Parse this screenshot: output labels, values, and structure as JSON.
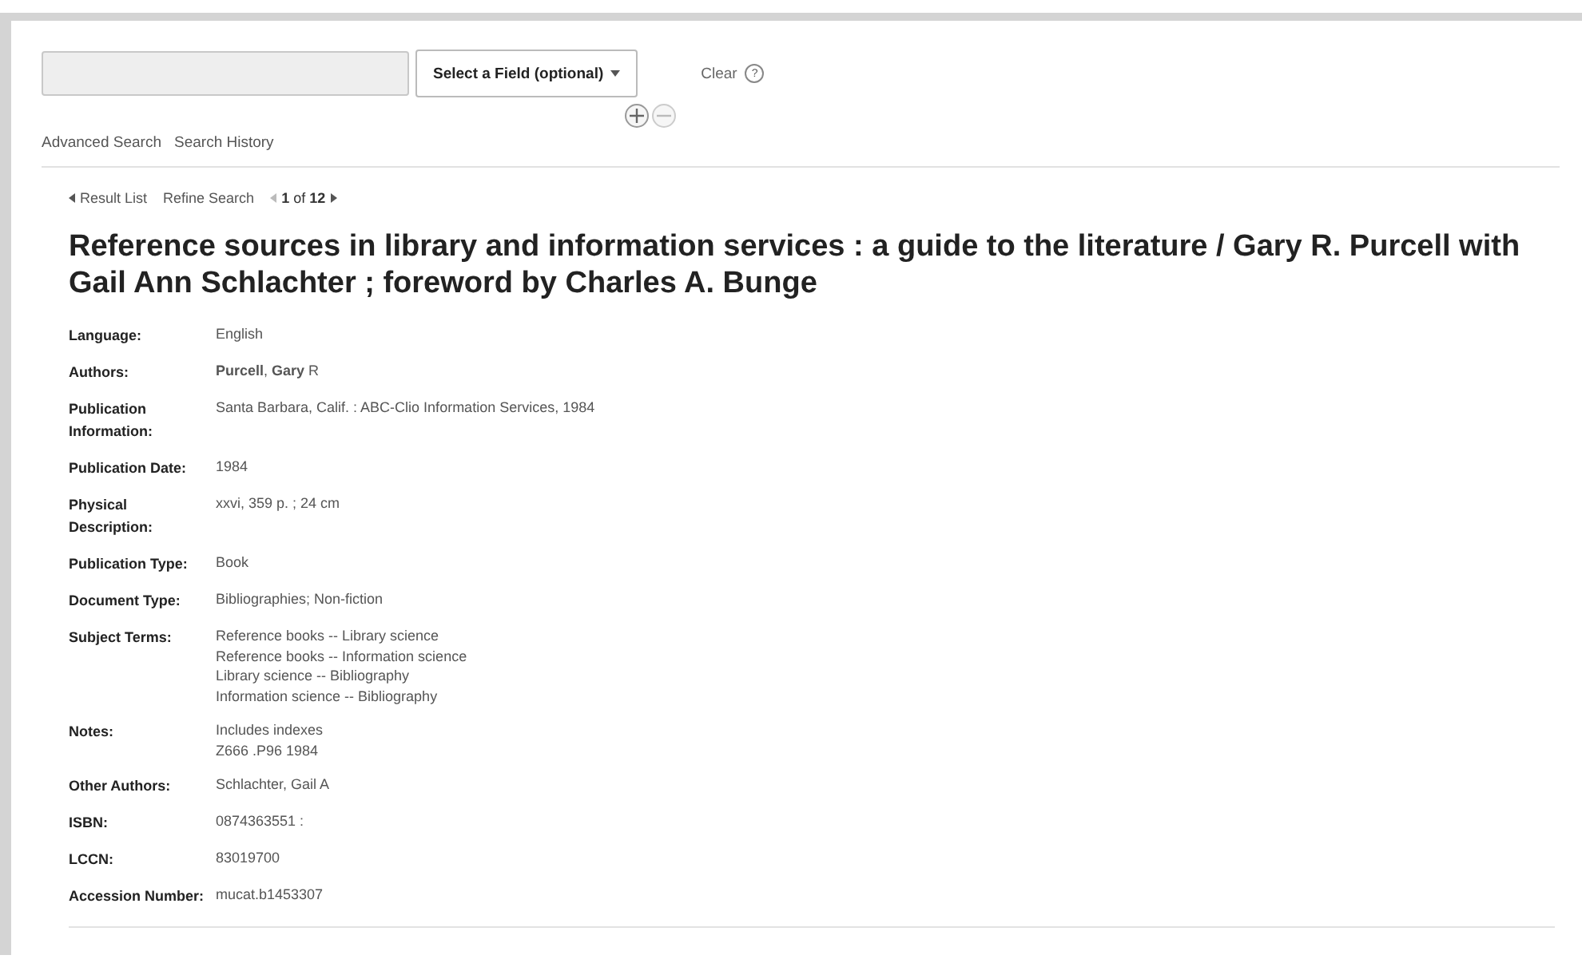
{
  "search": {
    "field_button": "Select a Field (optional)",
    "clear": "Clear",
    "help": "?"
  },
  "links": [
    "Advanced Search",
    "Search History"
  ],
  "nav": {
    "result_list": "Result List",
    "refine": "Refine Search",
    "position": "**1** of **12**"
  },
  "title": "Reference sources in library and information services : a guide to the literature / Gary R. Purcell with Gail Ann Schlachter ; foreword by Charles A. Bunge",
  "fields": [
    {
      "label": "Language:",
      "values": [
        "English"
      ]
    },
    {
      "label": "Authors:",
      "values": [
        "**Purcell**, **Gary** R"
      ]
    },
    {
      "label": "Publication Information:",
      "values": [
        "Santa Barbara, Calif. : ABC-Clio Information Services, 1984"
      ]
    },
    {
      "label": "Publication Date:",
      "values": [
        "1984"
      ]
    },
    {
      "label": "Physical Description:",
      "values": [
        "xxvi, 359 p. ; 24 cm"
      ]
    },
    {
      "label": "Publication Type:",
      "values": [
        "Book"
      ]
    },
    {
      "label": "Document Type:",
      "values": [
        "Bibliographies; Non-fiction"
      ]
    },
    {
      "label": "Subject Terms:",
      "values": [
        "Reference books -- Library science",
        "Reference books -- Information science",
        "Library science -- Bibliography",
        "Information science -- Bibliography"
      ]
    },
    {
      "label": "Notes:",
      "values": [
        "Includes indexes",
        "Z666 .P96 1984"
      ]
    },
    {
      "label": "Other Authors:",
      "values": [
        "Schlachter, Gail A"
      ]
    },
    {
      "label": "ISBN:",
      "values": [
        "0874363551 :"
      ]
    },
    {
      "label": "LCCN:",
      "values": [
        "83019700"
      ]
    },
    {
      "label": "Accession Number:",
      "values": [
        "mucat.b1453307"
      ]
    }
  ]
}
